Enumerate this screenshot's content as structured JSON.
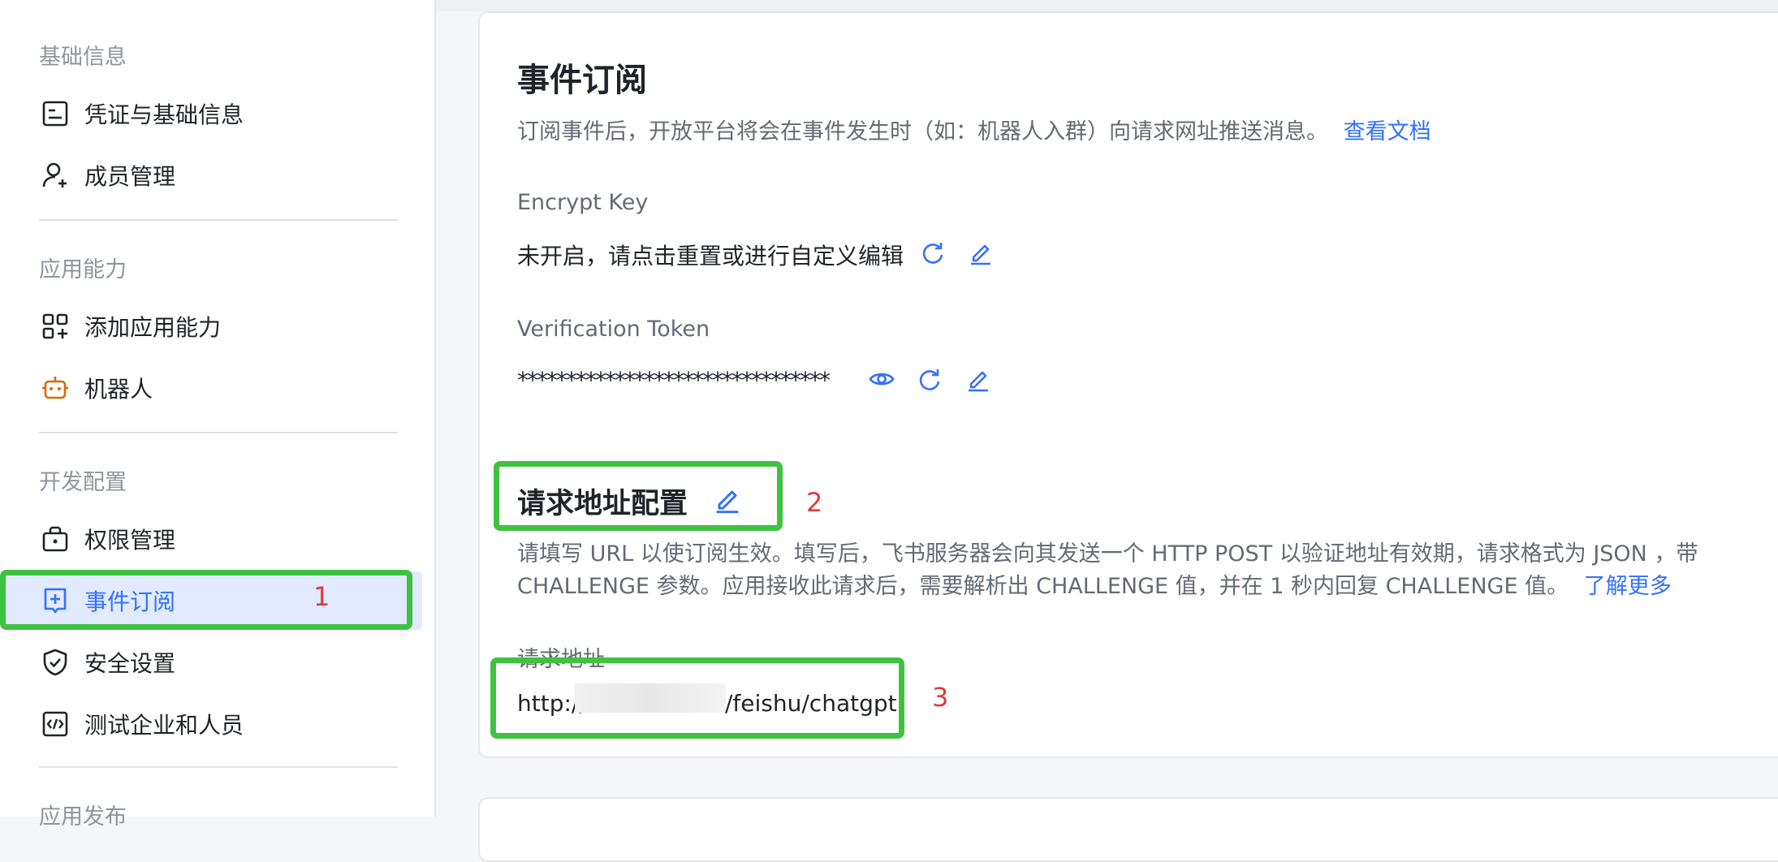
{
  "sidebar": {
    "sections": [
      {
        "title": "基础信息",
        "items": [
          {
            "label": "凭证与基础信息",
            "icon": "document-icon"
          },
          {
            "label": "成员管理",
            "icon": "user-add-icon"
          }
        ]
      },
      {
        "title": "应用能力",
        "items": [
          {
            "label": "添加应用能力",
            "icon": "app-grid-add-icon"
          },
          {
            "label": "机器人",
            "icon": "robot-icon"
          }
        ]
      },
      {
        "title": "开发配置",
        "items": [
          {
            "label": "权限管理",
            "icon": "lock-bag-icon"
          },
          {
            "label": "事件订阅",
            "icon": "event-subscribe-icon",
            "active": true
          },
          {
            "label": "安全设置",
            "icon": "shield-check-icon"
          },
          {
            "label": "测试企业和人员",
            "icon": "code-icon"
          }
        ]
      },
      {
        "title": "应用发布",
        "items": []
      }
    ]
  },
  "main": {
    "title": "事件订阅",
    "description": "订阅事件后，开放平台将会在事件发生时（如：机器人入群）向请求网址推送消息。",
    "doc_link": "查看文档",
    "encrypt_key": {
      "label": "Encrypt Key",
      "value": "未开启，请点击重置或进行自定义编辑"
    },
    "verification_token": {
      "label": "Verification Token",
      "value": "********************************"
    },
    "request_config": {
      "title": "请求地址配置",
      "desc_line1": "请填写 URL 以使订阅生效。填写后，飞书服务器会向其发送一个 HTTP POST 以验证地址有效期，请求格式为 JSON ，带",
      "desc_line2": "CHALLENGE 参数。应用接收此请求后，需要解析出 CHALLENGE 值，并在 1 秒内回复 CHALLENGE 值。",
      "learn_more": "了解更多",
      "url_label": "请求地址",
      "url_prefix": "http://",
      "url_suffix": "/feishu/chatgpt"
    }
  },
  "annotations": {
    "a1": "1",
    "a2": "2",
    "a3": "3"
  },
  "colors": {
    "accent": "#3370ff",
    "highlight_box": "#3fc23f",
    "annotation": "#e0393e",
    "robot_icon": "#d46b08"
  }
}
